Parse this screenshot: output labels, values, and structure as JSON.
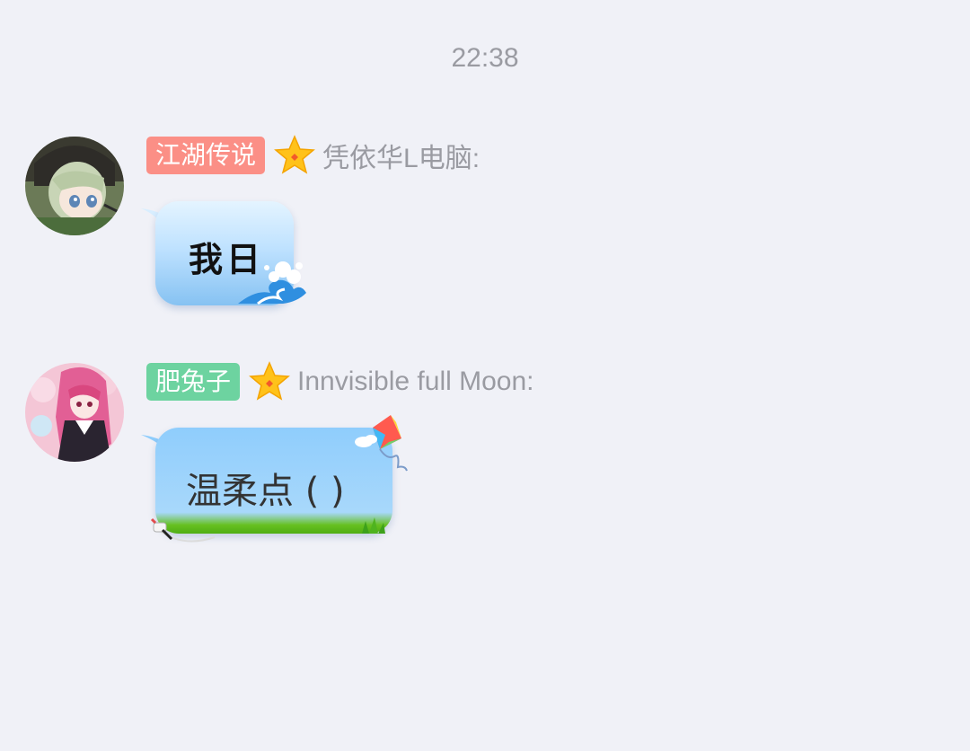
{
  "timestamp": "22:38",
  "messages": [
    {
      "title_badge": "江湖传说",
      "badge_color": "#fb8f86",
      "star_icon": "star-icon",
      "sender": "凭依华L电脑:",
      "text": "我日",
      "bubble_theme": "wave"
    },
    {
      "title_badge": "肥兔子",
      "badge_color": "#6dd3a0",
      "star_icon": "star-icon",
      "sender": "Innvisible full Moon:",
      "text": "温柔点 ( )",
      "bubble_theme": "kite"
    }
  ],
  "colors": {
    "background": "#f0f1f7",
    "meta_text": "#9a9ba2",
    "star": "#ffc21a"
  }
}
